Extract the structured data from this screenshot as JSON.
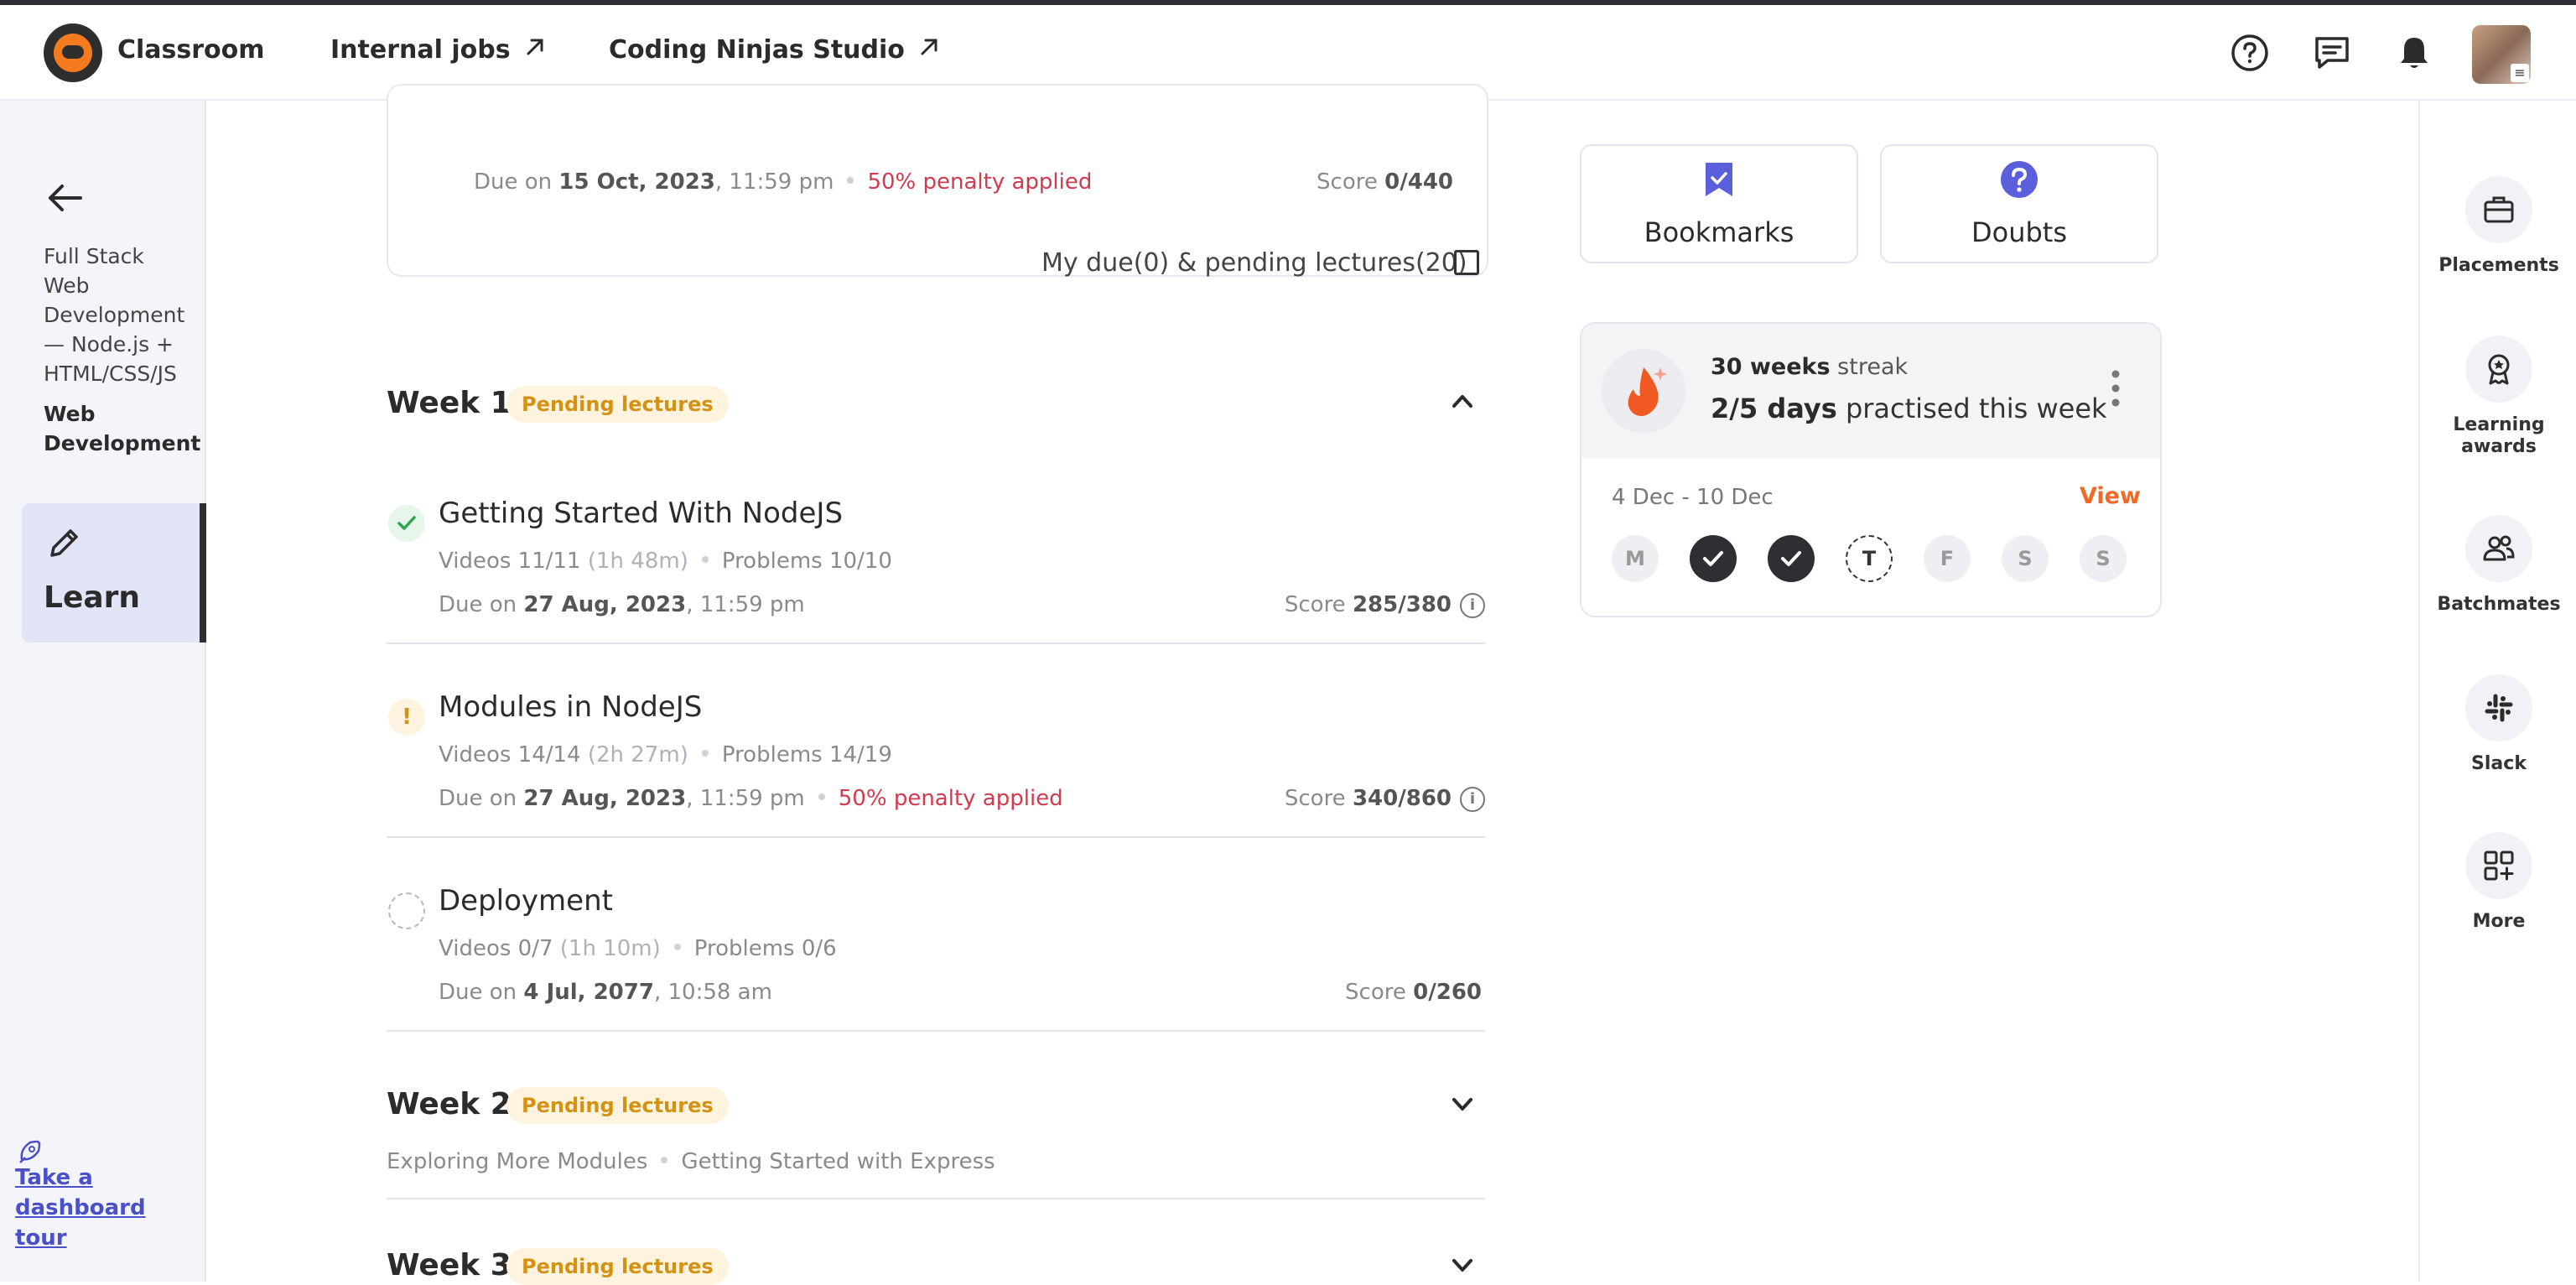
{
  "topbar": {
    "brand": "Classroom",
    "links": [
      {
        "label": "Internal jobs",
        "icon": "arrow-up-right-icon"
      },
      {
        "label": "Coding Ninjas Studio",
        "icon": "arrow-up-right-icon"
      }
    ],
    "icons": [
      "help-icon",
      "chat-icon",
      "bell-icon"
    ]
  },
  "leftnav": {
    "course": "Full Stack Web Development — Node.js + HTML/CSS/JS",
    "subject": "Web Development",
    "learn_label": "Learn",
    "tour_label": "Take a dashboard tour"
  },
  "prev_item": {
    "due_prefix": "Due on",
    "due_date": "15 Oct, 2023",
    "due_time": ", 11:59 pm",
    "penalty": "50% penalty applied",
    "score_label": "Score",
    "score_value": "0/440"
  },
  "filter": {
    "label": "My due(0) & pending lectures(20)"
  },
  "weeks": [
    {
      "title": "Week 1",
      "badge": "Pending lectures"
    },
    {
      "title": "Week 2",
      "badge": "Pending lectures",
      "subtopics": [
        "Exploring More Modules",
        "Getting Started with Express"
      ]
    },
    {
      "title": "Week 3",
      "badge": "Pending lectures"
    }
  ],
  "lectures": [
    {
      "title": "Getting Started With NodeJS",
      "status": "completed",
      "videos": "Videos 11/11",
      "duration": "(1h 48m)",
      "problems": "Problems 10/10",
      "due_prefix": "Due on",
      "due_date": "27 Aug, 2023",
      "due_time": ", 11:59 pm",
      "score_label": "Score",
      "score_value": "285/380"
    },
    {
      "title": "Modules in NodeJS",
      "status": "warning",
      "videos": "Videos 14/14",
      "duration": "(2h 27m)",
      "problems": "Problems 14/19",
      "due_prefix": "Due on",
      "due_date": "27 Aug, 2023",
      "due_time": ", 11:59 pm",
      "penalty": "50% penalty applied",
      "score_label": "Score",
      "score_value": "340/860"
    },
    {
      "title": "Deployment",
      "status": "not-started",
      "videos": "Videos 0/7",
      "duration": "(1h 10m)",
      "problems": "Problems 0/6",
      "due_prefix": "Due on",
      "due_date": "4 Jul, 2077",
      "due_time": ", 10:58 am",
      "score_label": "Score",
      "score_value": "0/260"
    }
  ],
  "quick": {
    "bookmarks": "Bookmarks",
    "doubts": "Doubts"
  },
  "streak": {
    "weeks_value": "30 weeks",
    "weeks_suffix": "streak",
    "days_value": "2/5 days",
    "days_suffix": "practised this week",
    "range": "4 Dec - 10 Dec",
    "view": "View",
    "days": [
      {
        "label": "M",
        "state": "missed"
      },
      {
        "label": "",
        "state": "done"
      },
      {
        "label": "",
        "state": "done"
      },
      {
        "label": "T",
        "state": "today"
      },
      {
        "label": "F",
        "state": "upcoming"
      },
      {
        "label": "S",
        "state": "upcoming"
      },
      {
        "label": "S",
        "state": "upcoming"
      }
    ]
  },
  "rightrail": [
    {
      "label": "Placements",
      "icon": "briefcase-icon"
    },
    {
      "label": "Learning awards",
      "icon": "award-icon"
    },
    {
      "label": "Batchmates",
      "icon": "users-icon"
    },
    {
      "label": "Slack",
      "icon": "slack-icon"
    },
    {
      "label": "More",
      "icon": "grid-plus-icon"
    }
  ],
  "colors": {
    "accent": "#f06a25",
    "penalty": "#d23a4e",
    "badge": "#d49214",
    "bookmark": "#5b5fdb"
  }
}
